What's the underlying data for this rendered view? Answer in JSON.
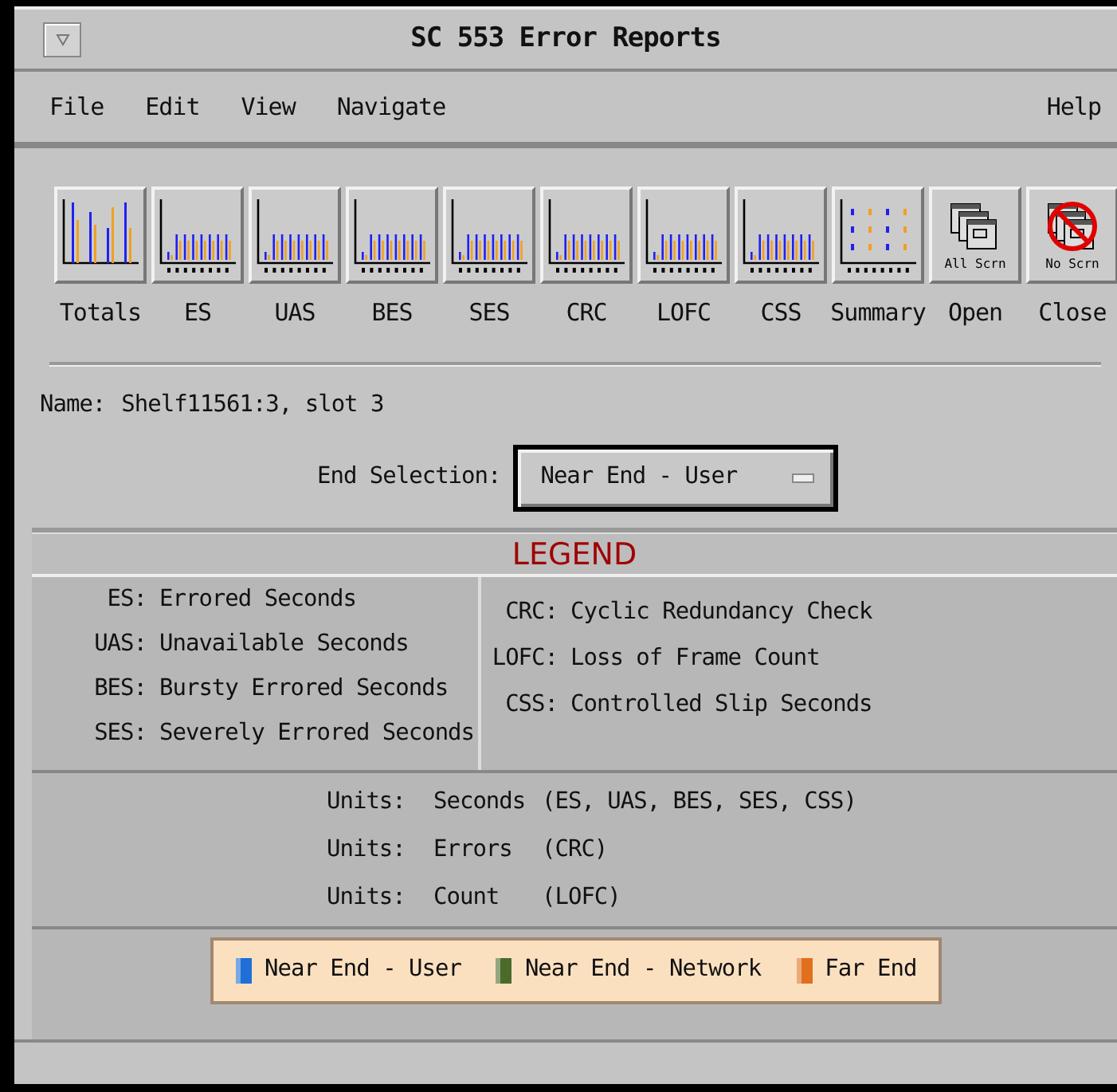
{
  "window": {
    "title": "SC 553 Error Reports"
  },
  "menu": {
    "left": [
      "File",
      "Edit",
      "View",
      "Navigate"
    ],
    "right": [
      "Help"
    ]
  },
  "toolbar": [
    {
      "label": "Totals",
      "kind": "totals"
    },
    {
      "label": "ES",
      "kind": "bars"
    },
    {
      "label": "UAS",
      "kind": "bars"
    },
    {
      "label": "BES",
      "kind": "bars"
    },
    {
      "label": "SES",
      "kind": "bars"
    },
    {
      "label": "CRC",
      "kind": "bars"
    },
    {
      "label": "LOFC",
      "kind": "bars"
    },
    {
      "label": "CSS",
      "kind": "bars"
    },
    {
      "label": "Summary",
      "kind": "summary"
    },
    {
      "label": "Open",
      "kind": "screens",
      "caption": "All Scrn"
    },
    {
      "label": "Close",
      "kind": "no-screens",
      "caption": "No Scrn"
    }
  ],
  "name": {
    "label": "Name:",
    "value": "Shelf11561:3, slot 3"
  },
  "end_selection": {
    "label": "End Selection:",
    "value": "Near End - User"
  },
  "legend": {
    "title": "LEGEND",
    "left": [
      {
        "abbr": "ES:",
        "text": "Errored Seconds"
      },
      {
        "abbr": "UAS:",
        "text": "Unavailable Seconds"
      },
      {
        "abbr": "BES:",
        "text": "Bursty Errored Seconds"
      },
      {
        "abbr": "SES:",
        "text": "Severely Errored Seconds"
      }
    ],
    "right": [
      {
        "abbr": "CRC:",
        "text": "Cyclic Redundancy Check"
      },
      {
        "abbr": "LOFC:",
        "text": "Loss of Frame Count"
      },
      {
        "abbr": "CSS:",
        "text": "Controlled Slip Seconds"
      }
    ]
  },
  "units": [
    {
      "label": "Units:",
      "unit": "Seconds",
      "scope": "(ES, UAS, BES, SES, CSS)"
    },
    {
      "label": "Units:",
      "unit": "Errors",
      "scope": "(CRC)"
    },
    {
      "label": "Units:",
      "unit": "Count",
      "scope": "(LOFC)"
    }
  ],
  "series_key": [
    {
      "label": "Near End - User",
      "color": "#1f6fd6"
    },
    {
      "label": "Near End - Network",
      "color": "#4b6b2b"
    },
    {
      "label": "Far End",
      "color": "#e0701e"
    }
  ]
}
